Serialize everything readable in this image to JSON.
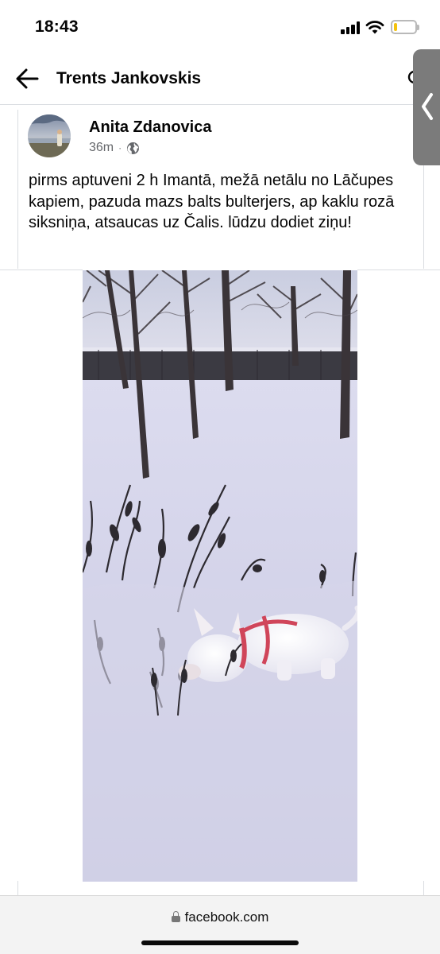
{
  "status_bar": {
    "time": "18:43",
    "battery_level": 0.15,
    "battery_color": "#f4c20d"
  },
  "header": {
    "title": "Trents Jankovskis",
    "back_icon": "arrow-left-icon",
    "search_icon": "search-icon"
  },
  "side_tab": {
    "icon": "chevron-left-icon"
  },
  "post": {
    "author": "Anita Zdanovica",
    "time_ago": "36m",
    "separator": "·",
    "audience_icon": "globe-icon",
    "text": "pirms aptuveni 2 h Imantā, mežā netālu no Lāčupes kapiem, pazuda mazs balts bulterjers, ap kaklu rozā siksniņa, atsaucas uz Čalis. lūdzu dodiet ziņu!"
  },
  "browser": {
    "url": "facebook.com",
    "lock_icon": "lock-icon"
  },
  "colors": {
    "text": "#050505",
    "meta": "#65676b",
    "divider": "#dadde1",
    "harness": "#d0455a"
  }
}
